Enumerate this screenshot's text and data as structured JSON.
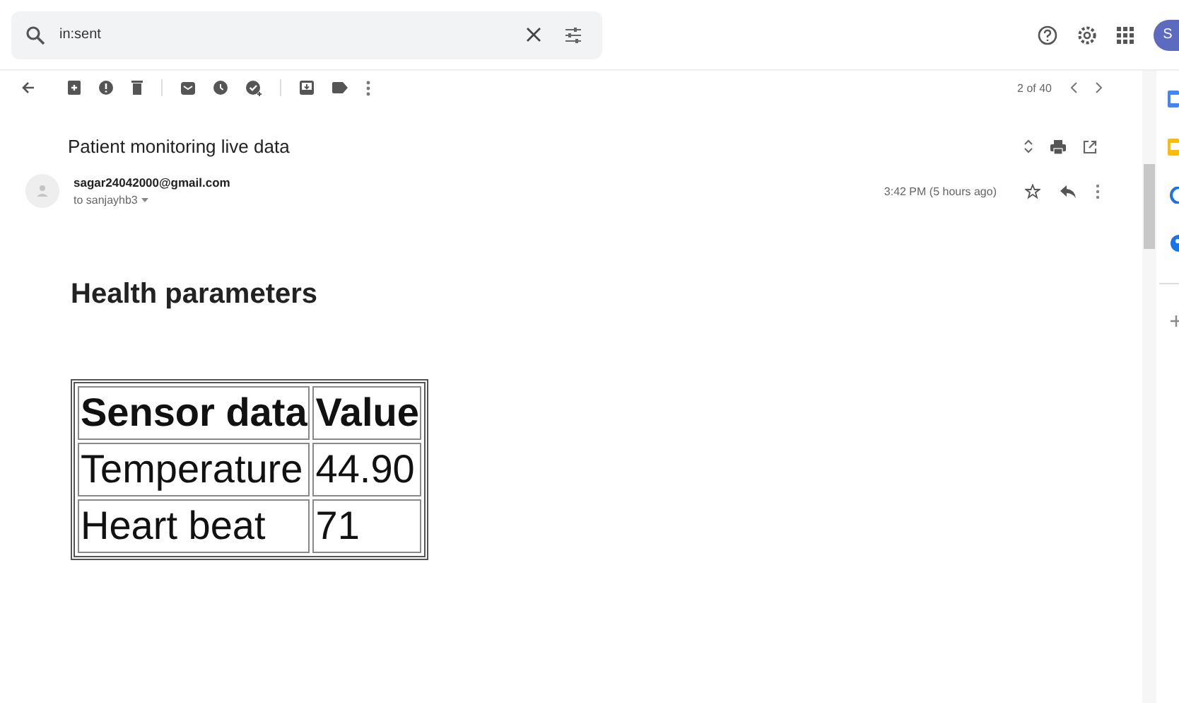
{
  "search": {
    "value": "in:sent"
  },
  "avatar": {
    "letter": "S"
  },
  "pager": {
    "text": "2 of 40"
  },
  "subject": "Patient monitoring live data",
  "sender": {
    "email": "sagar24042000@gmail.com",
    "to": "to sanjayhb3",
    "time": "3:42 PM (5 hours ago)"
  },
  "body": {
    "heading": "Health parameters",
    "table": {
      "columns": [
        "Sensor data",
        "Value"
      ],
      "rows": [
        [
          "Temperature",
          "44.90"
        ],
        [
          "Heart beat",
          "71"
        ]
      ]
    }
  }
}
